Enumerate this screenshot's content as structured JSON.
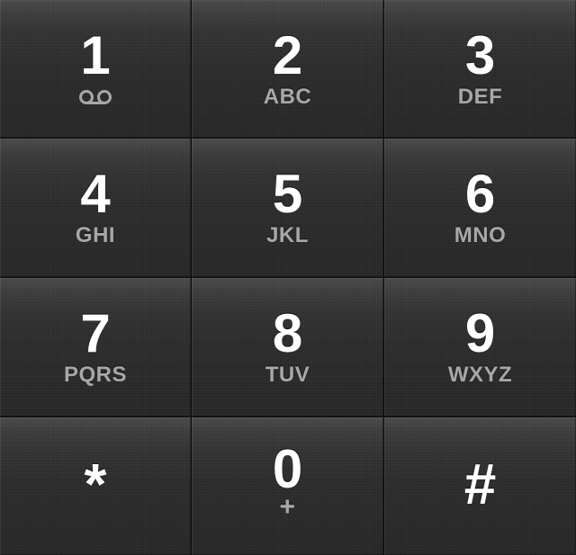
{
  "keypad": {
    "keys": [
      {
        "digit": "1",
        "sub": "",
        "sub_icon": "voicemail-icon"
      },
      {
        "digit": "2",
        "sub": "ABC"
      },
      {
        "digit": "3",
        "sub": "DEF"
      },
      {
        "digit": "4",
        "sub": "GHI"
      },
      {
        "digit": "5",
        "sub": "JKL"
      },
      {
        "digit": "6",
        "sub": "MNO"
      },
      {
        "digit": "7",
        "sub": "PQRS"
      },
      {
        "digit": "8",
        "sub": "TUV"
      },
      {
        "digit": "9",
        "sub": "WXYZ"
      },
      {
        "digit": "*",
        "sub": ""
      },
      {
        "digit": "0",
        "sub": "+"
      },
      {
        "digit": "#",
        "sub": ""
      }
    ],
    "colors": {
      "digit": "#ffffff",
      "letters": "#a8a8a8",
      "key_top": "#4a4a4a",
      "key_bottom": "#272727",
      "divider": "#0c0c0c"
    }
  }
}
